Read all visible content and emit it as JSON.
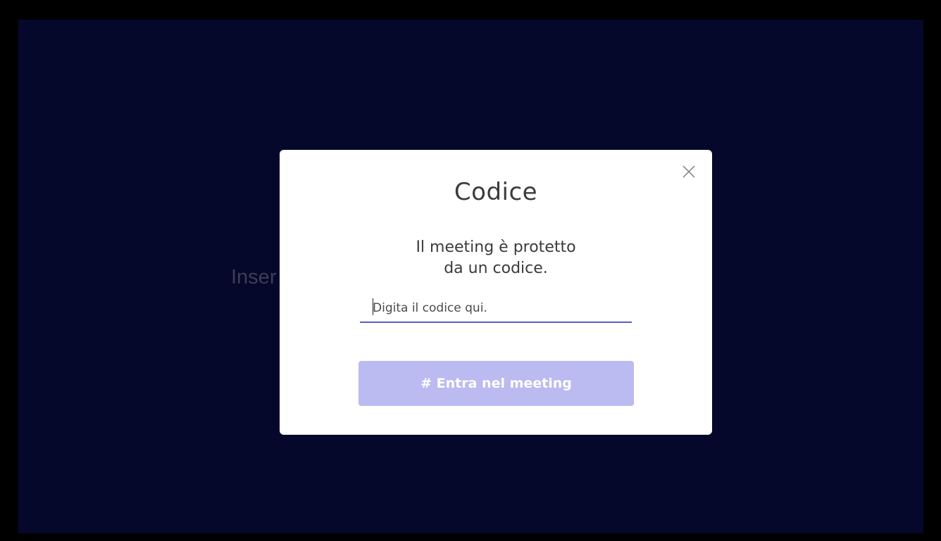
{
  "background": {
    "text": "Inser",
    "color": "#05082b"
  },
  "modal": {
    "close_icon": "close-icon",
    "title": "Codice",
    "description_line1": "Il meeting è protetto",
    "description_line2": "da un codice.",
    "input": {
      "placeholder": "Digita il codice qui.",
      "value": ""
    },
    "submit_label": "# Entra nel meeting",
    "accent_color": "#5b5bd6",
    "button_color": "#bbbaf1"
  }
}
